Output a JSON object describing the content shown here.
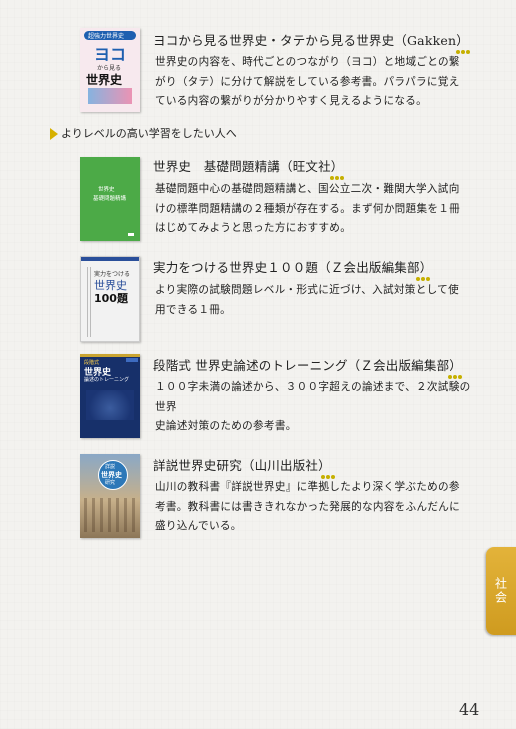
{
  "section_heading": "よりレベルの高い学習をしたい人へ",
  "tab_label": "社会",
  "page_number": "44",
  "accent_color": "#c6b000",
  "books": [
    {
      "title": "ヨコから見る世界史・タテから見る世界史（Gakken）",
      "desc_lines": [
        "世界史の内容を、時代ごとのつながり（ヨコ）と地域ごとの繋",
        "がり（タテ）に分けて解説をしている参考書。パラパラに覚え",
        "ている内容の繋がりが分かりやすく見えるようになる。"
      ],
      "cover": {
        "band": "超強力世界史",
        "big": "ヨコ",
        "sub": "から見る",
        "main": "世界史"
      }
    },
    {
      "title": "世界史　基礎問題精講（旺文社）",
      "desc_lines": [
        "基礎問題中心の基礎問題精講と、国公立二次・難関大学入試向",
        "けの標準問題精講の２種類が存在する。まず何か問題集を１冊",
        "はじめてみようと思った方におすすめ。"
      ],
      "cover": {
        "line1": "世界史",
        "line2": "基礎問題精講"
      }
    },
    {
      "title": "実力をつける世界史１００題（Ｚ会出版編集部）",
      "desc_lines": [
        "より実際の試験問題レベル・形式に近づけ、入試対策として使",
        "用できる１冊。"
      ],
      "cover": {
        "line1": "実力をつける",
        "line2": "世界史",
        "line3": "100題"
      }
    },
    {
      "title": "段階式 世界史論述のトレーニング（Ｚ会出版編集部）",
      "desc_lines": [
        "１００字未満の論述から、３００字超えの論述まで、２次試験の世界",
        "史論述対策のための参考書。"
      ],
      "cover": {
        "line1": "段階式",
        "line2": "世界史",
        "line3": "論述のトレーニング"
      }
    },
    {
      "title": "詳説世界史研究（山川出版社）",
      "desc_lines": [
        "山川の教科書『詳説世界史』に準拠したより深く学ぶための参",
        "考書。教科書には書ききれなかった発展的な内容をふんだんに",
        "盛り込んでいる。"
      ],
      "cover": {
        "line1": "詳説",
        "line2": "世界史",
        "line3": "研究"
      }
    }
  ]
}
